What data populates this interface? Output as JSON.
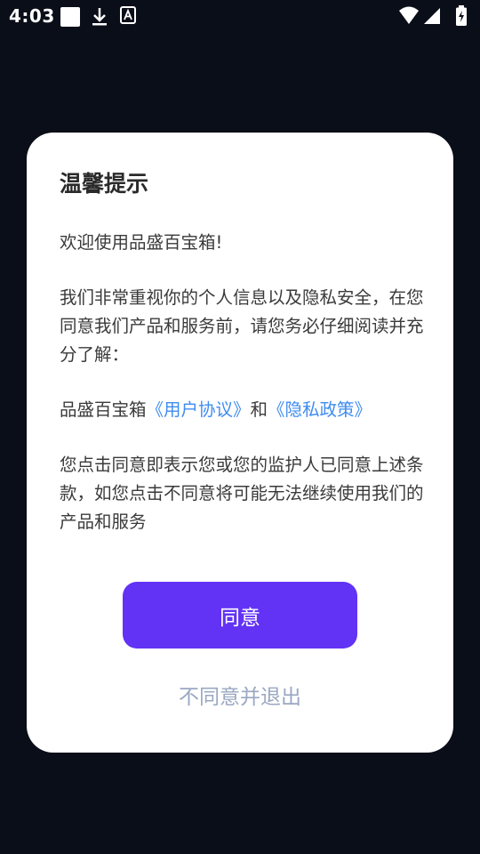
{
  "status_bar": {
    "time": "4:03",
    "left_icons": [
      "blank-square-icon",
      "download-icon",
      "font-app-icon"
    ],
    "right_icons": [
      "wifi-icon",
      "cellular-signal-icon",
      "battery-charging-icon"
    ]
  },
  "dialog": {
    "title": "温馨提示",
    "welcome": "欢迎使用品盛百宝箱!",
    "intro": "我们非常重视你的个人信息以及隐私安全，在您同意我们产品和服务前，请您务必仔细阅读并充分了解：",
    "policy_prefix": "品盛百宝箱",
    "user_agreement_link": "《用户协议》",
    "policy_and": "和",
    "privacy_policy_link": "《隐私政策》",
    "notice": "您点击同意即表示您或您的监护人已同意上述条款，如您点击不同意将可能无法继续使用我们的产品和服务",
    "agree_label": "同意",
    "decline_label": "不同意并退出"
  },
  "colors": {
    "background": "#0a0e18",
    "accent": "#6232f5",
    "link": "#3f8cf0",
    "decline_text": "#9aa8c2"
  }
}
